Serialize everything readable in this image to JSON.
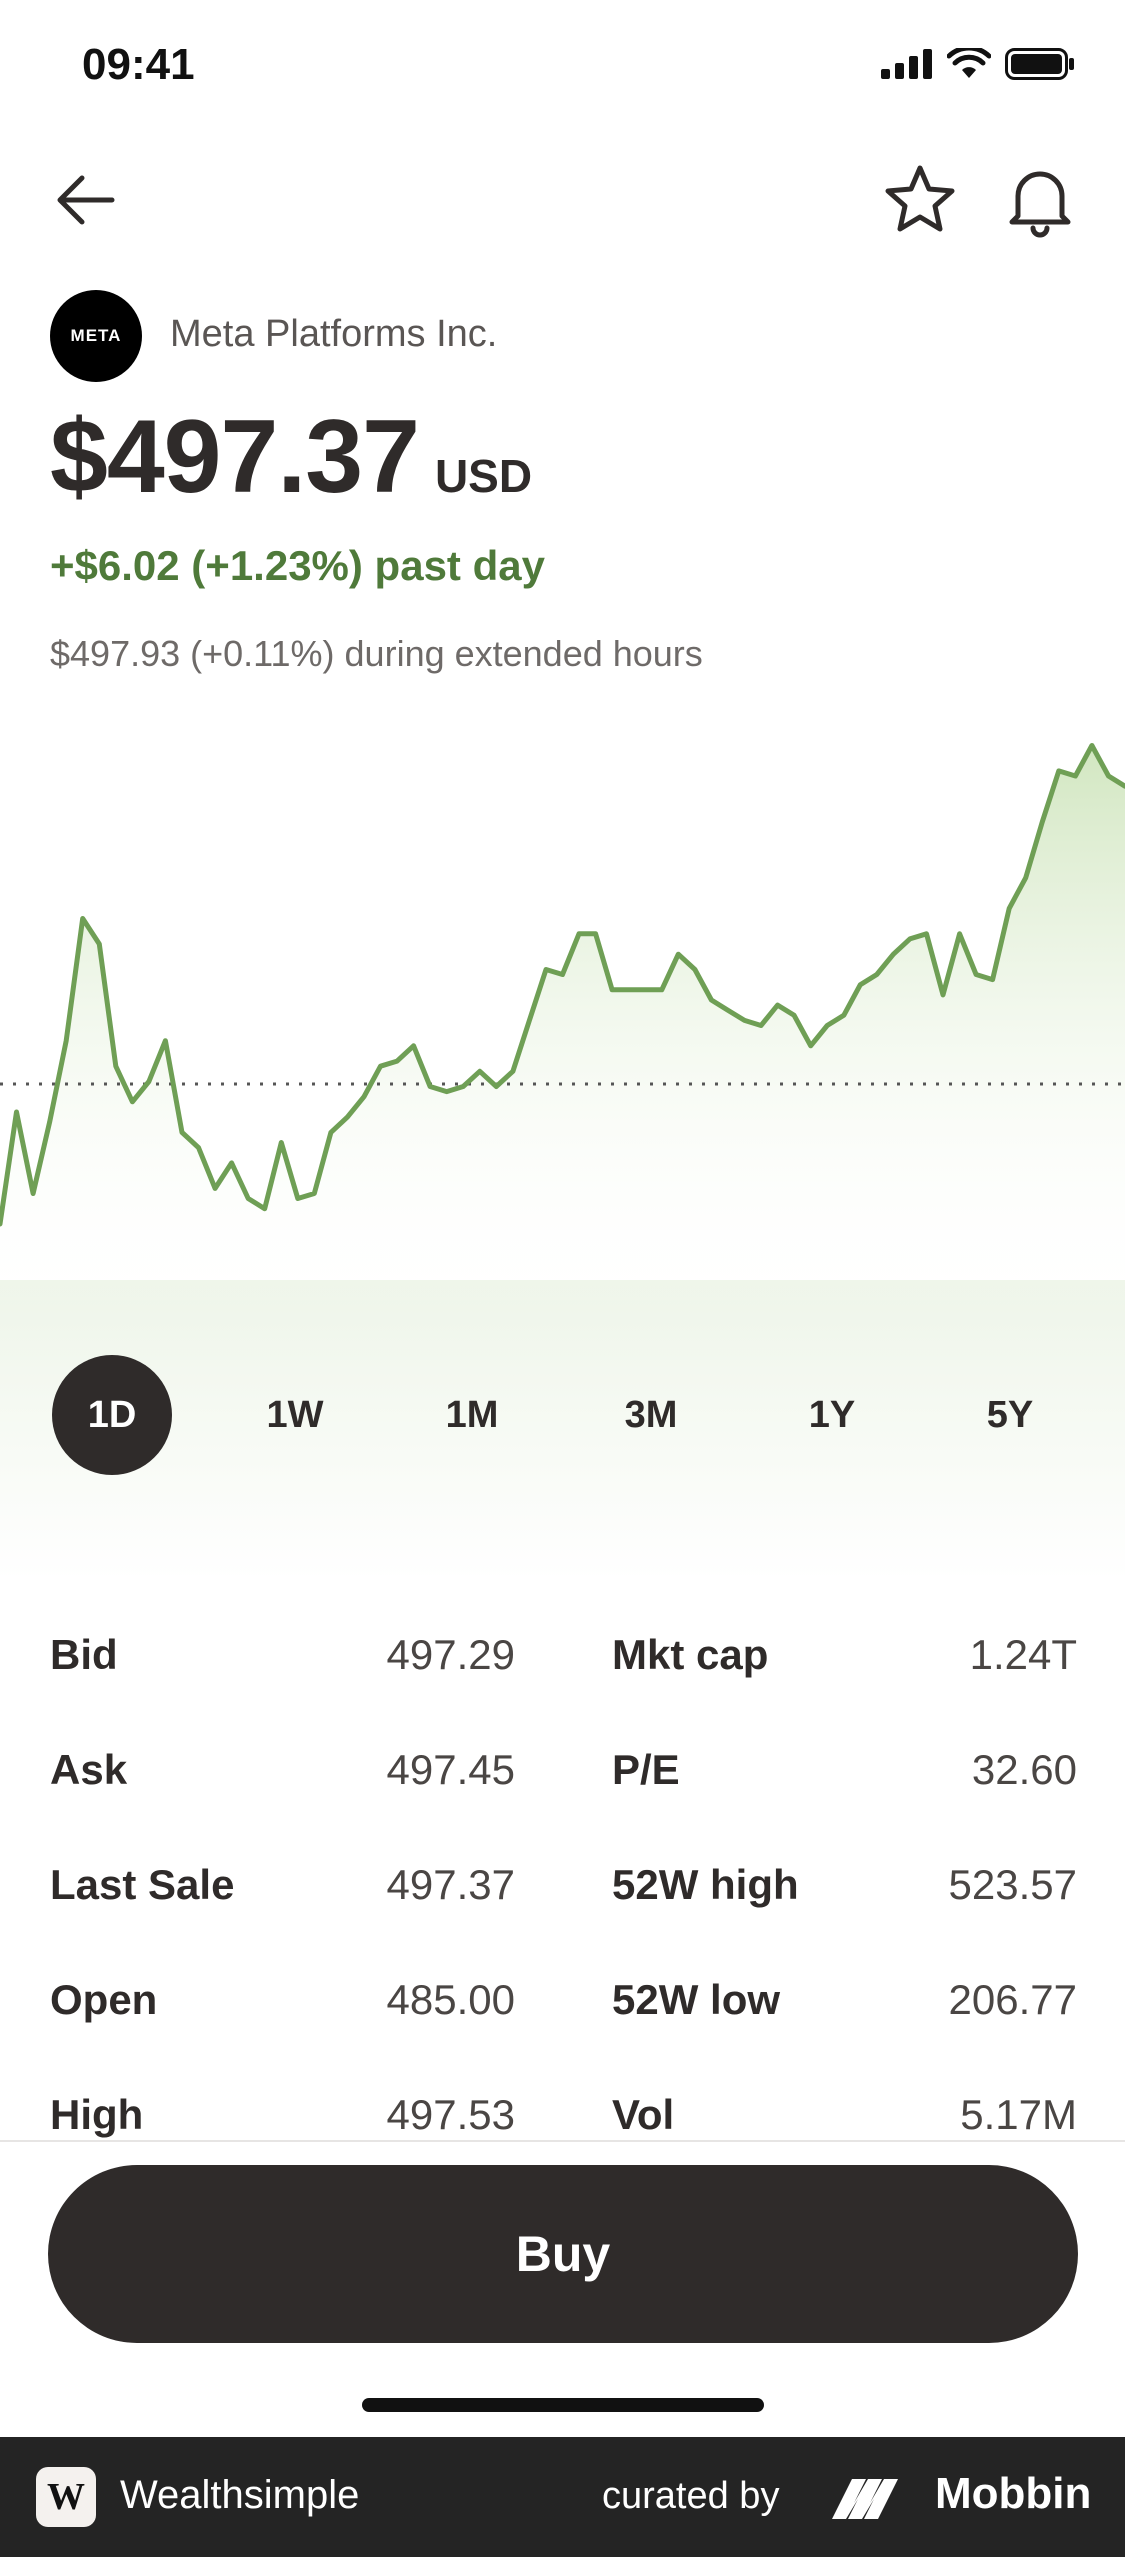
{
  "status_bar": {
    "time": "09:41"
  },
  "stock": {
    "logo_text": "META",
    "company": "Meta Platforms Inc.",
    "price": "$497.37",
    "currency": "USD",
    "change": "+$6.02 (+1.23%) past day",
    "extended": "$497.93 (+0.11%) during extended hours"
  },
  "ranges": [
    {
      "label": "1D",
      "active": true
    },
    {
      "label": "1W",
      "active": false
    },
    {
      "label": "1M",
      "active": false
    },
    {
      "label": "3M",
      "active": false
    },
    {
      "label": "1Y",
      "active": false
    },
    {
      "label": "5Y",
      "active": false
    }
  ],
  "stats": {
    "left": [
      {
        "label": "Bid",
        "value": "497.29"
      },
      {
        "label": "Ask",
        "value": "497.45"
      },
      {
        "label": "Last Sale",
        "value": "497.37"
      },
      {
        "label": "Open",
        "value": "485.00"
      },
      {
        "label": "High",
        "value": "497.53"
      }
    ],
    "right": [
      {
        "label": "Mkt cap",
        "value": "1.24T"
      },
      {
        "label": "P/E",
        "value": "32.60"
      },
      {
        "label": "52W high",
        "value": "523.57"
      },
      {
        "label": "52W low",
        "value": "206.77"
      },
      {
        "label": "Vol",
        "value": "5.17M"
      }
    ]
  },
  "actions": {
    "buy_label": "Buy"
  },
  "footer": {
    "brand": "Wealthsimple",
    "curated": "curated by",
    "mobbin": "Mobbin",
    "logo_letter": "W"
  },
  "colors": {
    "accent_green": "#4f7a3a",
    "line_green": "#6f9f55",
    "dark": "#2f2b2a"
  },
  "chart_data": {
    "type": "area",
    "previous_close": 491.35,
    "ylim": [
      487.5,
      498.5
    ],
    "values": [
      488.6,
      490.8,
      489.2,
      490.6,
      492.2,
      494.6,
      494.1,
      491.7,
      491.0,
      491.4,
      492.2,
      490.4,
      490.1,
      489.3,
      489.8,
      489.1,
      488.9,
      490.2,
      489.1,
      489.2,
      490.4,
      490.7,
      491.1,
      491.7,
      491.8,
      492.1,
      491.3,
      491.2,
      491.3,
      491.6,
      491.3,
      491.6,
      492.6,
      493.6,
      493.5,
      494.3,
      494.3,
      493.2,
      493.2,
      493.2,
      493.2,
      493.9,
      493.6,
      493.0,
      492.8,
      492.6,
      492.5,
      492.9,
      492.7,
      492.1,
      492.5,
      492.7,
      493.3,
      493.5,
      493.9,
      494.2,
      494.3,
      493.1,
      494.3,
      493.5,
      493.4,
      494.8,
      495.4,
      496.5,
      497.5,
      497.4,
      498.0,
      497.4,
      497.2
    ]
  }
}
